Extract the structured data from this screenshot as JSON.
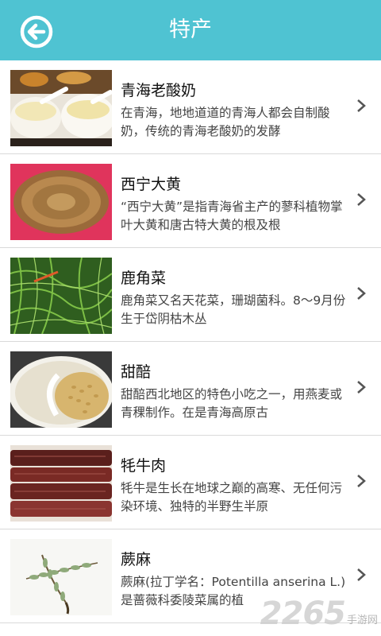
{
  "header": {
    "title": "特产",
    "back_icon": "back-arrow-circle-icon",
    "color": "#4fc3d2"
  },
  "items": [
    {
      "title": "青海老酸奶",
      "desc": "在青海，地地道道的青海人都会自制酸奶，传统的青海老酸奶的发酵",
      "image": "yogurt-bowls-photo"
    },
    {
      "title": "西宁大黄",
      "desc": "“西宁大黄”是指青海省主产的蓼科植物掌叶大黄和唐古特大黄的根及根",
      "image": "rhubarb-slice-photo"
    },
    {
      "title": "鹿角菜",
      "desc": "鹿角菜又名天花菜，珊瑚菌科。8～9月份生于岱阴枯木丛",
      "image": "seaweed-salad-photo"
    },
    {
      "title": "甜醅",
      "desc": "甜醅西北地区的特色小吃之一，用燕麦或青稞制作。在是青海高原古",
      "image": "sweet-barley-bowl-photo"
    },
    {
      "title": "牦牛肉",
      "desc": "牦牛是生长在地球之巅的高寒、无任何污染环境、独特的半野生半原",
      "image": "dried-yak-beef-photo"
    },
    {
      "title": "蕨麻",
      "desc": "蕨麻(拉丁学名：Potentilla anserina L.)是蔷薇科委陵菜属的植",
      "image": "silverweed-plant-photo"
    }
  ],
  "watermark": {
    "number": "2265",
    "text": "手游网"
  }
}
